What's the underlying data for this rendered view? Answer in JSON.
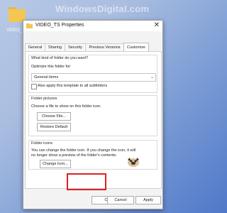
{
  "desktop": {
    "folder_label": "VIDEO_TS",
    "watermark": "WindowsDigital.com"
  },
  "window": {
    "title": "VIDEO_TS Properties",
    "tabs": [
      "General",
      "Sharing",
      "Security",
      "Previous Versions",
      "Customize"
    ],
    "active_tab": "Customize"
  },
  "customize": {
    "kind_label": "What kind of folder do you want?",
    "optimize_label": "Optimize this folder for:",
    "optimize_value": "General items",
    "apply_template_label": "Also apply this template to all subfolders",
    "apply_template_checked": false,
    "pictures_group": "Folder pictures",
    "pictures_text": "Choose a file to show on this folder icon.",
    "choose_file_button": "Choose File...",
    "restore_default_button": "Restore Default",
    "icons_group": "Folder icons",
    "icons_text_1": "You can change the folder icon. If you change the icon, it will",
    "icons_text_2": "no longer show a preview of the folder's contents.",
    "change_icon_button": "Change Icon..."
  },
  "footer": {
    "ok": "OK",
    "cancel": "Cancel",
    "apply": "Apply"
  },
  "colors": {
    "highlight": "#e02020",
    "accent": "#f4c652"
  }
}
